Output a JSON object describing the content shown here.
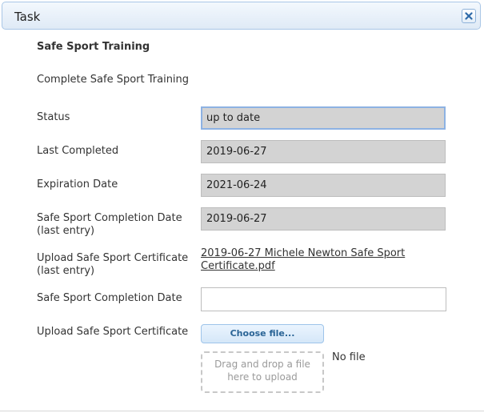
{
  "dialog": {
    "title": "Task",
    "close_icon": "close-x-icon"
  },
  "task": {
    "heading": "Safe Sport Training",
    "description": "Complete Safe Sport Training"
  },
  "fields": {
    "status": {
      "label": "Status",
      "value": "up to date"
    },
    "last_completed": {
      "label": "Last Completed",
      "value": "2019-06-27"
    },
    "expiration_date": {
      "label": "Expiration Date",
      "value": "2021-06-24"
    },
    "completion_last_entry": {
      "label": "Safe Sport Completion Date (last entry)",
      "value": "2019-06-27"
    },
    "certificate_last_entry": {
      "label": "Upload Safe Sport Certificate (last entry)",
      "file_link": "2019-06-27 Michele Newton Safe Sport Certificate.pdf"
    },
    "completion_date": {
      "label": "Safe Sport Completion Date",
      "value": ""
    },
    "upload_certificate": {
      "label": "Upload Safe Sport Certificate",
      "choose_button": "Choose file...",
      "dropzone_text": "Drag and drop a file here to upload",
      "file_status": "No file"
    }
  }
}
